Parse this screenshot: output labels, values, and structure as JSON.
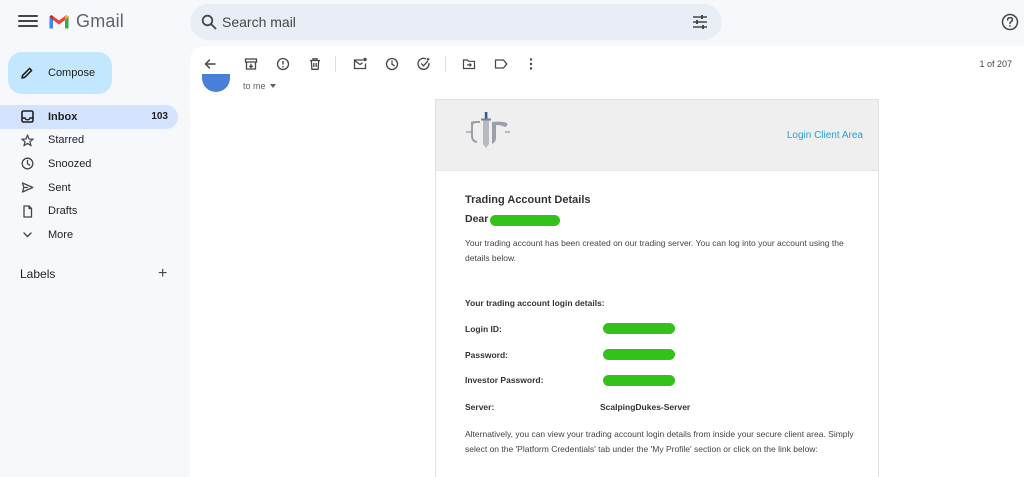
{
  "app": {
    "name": "Gmail"
  },
  "search": {
    "placeholder": "Search mail"
  },
  "sidebar": {
    "compose_label": "Compose",
    "items": [
      {
        "label": "Inbox",
        "count": "103",
        "icon": "inbox-icon",
        "active": true
      },
      {
        "label": "Starred",
        "icon": "star-icon"
      },
      {
        "label": "Snoozed",
        "icon": "clock-icon"
      },
      {
        "label": "Sent",
        "icon": "send-icon"
      },
      {
        "label": "Drafts",
        "icon": "file-icon"
      },
      {
        "label": "More",
        "icon": "chevron-down-icon"
      }
    ],
    "labels_heading": "Labels",
    "labels_add": "+"
  },
  "toolbar": {
    "pager": "1 of 207"
  },
  "message": {
    "recipient": "to me"
  },
  "email": {
    "header_link": "Login Client Area",
    "title": "Trading Account Details",
    "greeting": "Dear",
    "intro": "Your trading account has been created on our trading server. You can log into your account using the details below.",
    "details_heading": "Your trading account login details:",
    "login_id_label": "Login ID:",
    "password_label": "Password:",
    "investor_password_label": "Investor Password:",
    "server_label": "Server:",
    "server_value": "ScalpingDukes-Server",
    "outro": "Alternatively, you can view your trading account login details from inside your secure client area. Simply select on the 'Platform Credentials' tab under the 'My Profile' section or click on the link below:"
  },
  "colors": {
    "redaction": "#33c21a",
    "link": "#2a9fd6",
    "active_nav": "#d3e3fd",
    "compose": "#c2e7ff"
  }
}
